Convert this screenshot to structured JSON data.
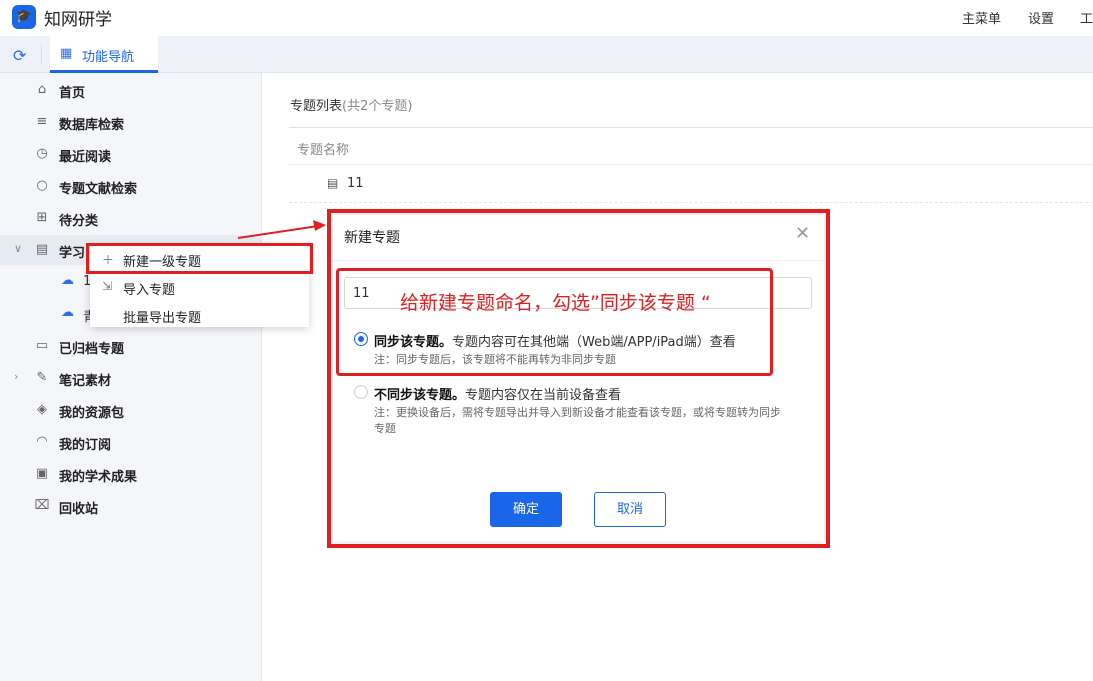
{
  "app": {
    "title": "知网研学",
    "logo_icon": "graduation-cap-icon"
  },
  "top_menu": [
    "主菜单",
    "设置",
    "工"
  ],
  "tabs": {
    "refresh_icon": "refresh-icon",
    "active_label": "功能导航",
    "active_icon": "grid-icon"
  },
  "sidebar": {
    "items": [
      {
        "label": "首页",
        "icon": "home-icon"
      },
      {
        "label": "数据库检索",
        "icon": "db-search-icon"
      },
      {
        "label": "最近阅读",
        "icon": "clock-icon"
      },
      {
        "label": "专题文献检索",
        "icon": "search-icon"
      },
      {
        "label": "待分类",
        "icon": "folder-plus-icon"
      },
      {
        "label": "学习",
        "icon": "book-icon"
      },
      {
        "label": "已归档专题",
        "icon": "archive-icon"
      },
      {
        "label": "笔记素材",
        "icon": "note-icon"
      },
      {
        "label": "我的资源包",
        "icon": "layers-icon"
      },
      {
        "label": "我的订阅",
        "icon": "rss-icon"
      },
      {
        "label": "我的学术成果",
        "icon": "doc-icon"
      },
      {
        "label": "回收站",
        "icon": "trash-icon"
      }
    ],
    "sub_items": [
      {
        "label": "1"
      },
      {
        "label": "青"
      }
    ]
  },
  "context_menu": {
    "items": [
      {
        "label": "新建一级专题",
        "icon": "plus-icon"
      },
      {
        "label": "导入专题",
        "icon": "import-icon"
      },
      {
        "label": "批量导出专题",
        "icon": ""
      }
    ]
  },
  "list": {
    "title": "专题列表",
    "count": "(共2个专题)",
    "column_header": "专题名称",
    "rows": [
      {
        "label": "11"
      }
    ]
  },
  "modal": {
    "title": "新建专题",
    "input_value": "11",
    "option_sync": {
      "bold": "同步该专题。",
      "text": "专题内容可在其他端（Web端/APP/iPad端）查看",
      "note": "注：同步专题后，该专题将不能再转为非同步专题",
      "checked": true
    },
    "option_nosync": {
      "bold": "不同步该专题。",
      "text": "专题内容仅在当前设备查看",
      "note": "注：更换设备后，需将专题导出并导入到新设备才能查看该专题，或将专题转为同步专题",
      "checked": false
    },
    "ok_label": "确定",
    "cancel_label": "取消"
  },
  "annotation": {
    "text": "给新建专题命名，勾选”同步该专题 “",
    "color": "#e02020"
  },
  "colors": {
    "accent": "#1a66e8",
    "highlight": "#e02020"
  }
}
